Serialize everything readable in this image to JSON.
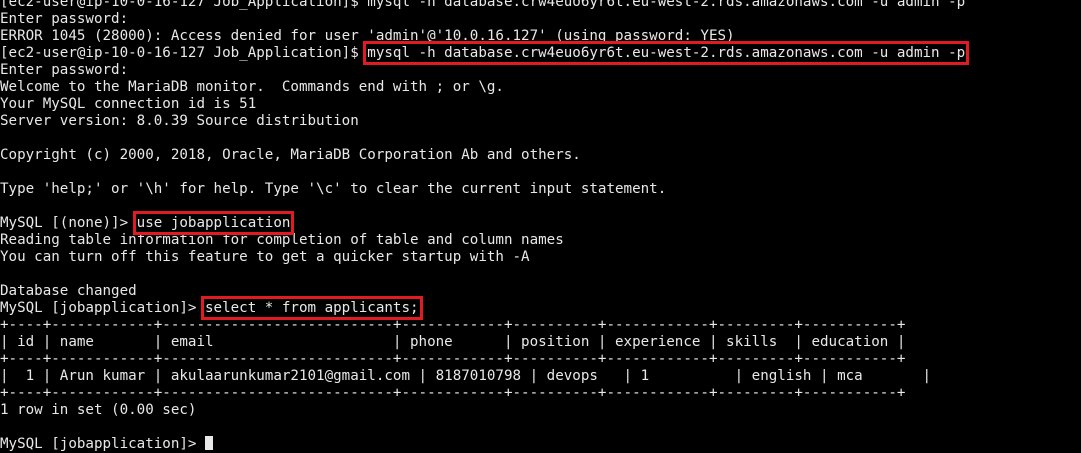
{
  "terminal": {
    "line_01": "[ec2-user@ip-10-0-16-127 Job_Application]$ mysql -h database.crw4euo6yr6t.eu-west-2.rds.amazonaws.com -u admin -p",
    "line_02": "Enter password:",
    "line_03": "ERROR 1045 (28000): Access denied for user 'admin'@'10.0.16.127' (using password: YES)",
    "line_04_prompt": "[ec2-user@ip-10-0-16-127 Job_Application]$ ",
    "line_04_command": "mysql -h database.crw4euo6yr6t.eu-west-2.rds.amazonaws.com -u admin -p",
    "line_05": "Enter password:",
    "line_06": "Welcome to the MariaDB monitor.  Commands end with ; or \\g.",
    "line_07": "Your MySQL connection id is 51",
    "line_08": "Server version: 8.0.39 Source distribution",
    "line_09": "",
    "line_10": "Copyright (c) 2000, 2018, Oracle, MariaDB Corporation Ab and others.",
    "line_11": "",
    "line_12": "Type 'help;' or '\\h' for help. Type '\\c' to clear the current input statement.",
    "line_13": "",
    "line_14_prompt": "MySQL [(none)]> ",
    "line_14_command": "use jobapplication",
    "line_15": "Reading table information for completion of table and column names",
    "line_16": "You can turn off this feature to get a quicker startup with -A",
    "line_17": "",
    "line_18": "Database changed",
    "line_19_prompt": "MySQL [jobapplication]> ",
    "line_19_command": "select * from applicants;",
    "line_20": "+----+------------+---------------------------+------------+----------+------------+---------+-----------+",
    "line_21": "| id | name       | email                     | phone      | position | experience | skills  | education |",
    "line_22": "+----+------------+---------------------------+------------+----------+------------+---------+-----------+",
    "line_23": "|  1 | Arun kumar | akulaarunkumar2101@gmail.com | 8187010798 | devops   | 1          | english | mca       |",
    "line_24": "+----+------------+---------------------------+------------+----------+------------+---------+-----------+",
    "line_25": "1 row in set (0.00 sec)",
    "line_26": "",
    "line_27": "MySQL [jobapplication]> "
  },
  "colors": {
    "background": "#000000",
    "text": "#e8e8e8",
    "highlight_box": "#e01b24"
  }
}
